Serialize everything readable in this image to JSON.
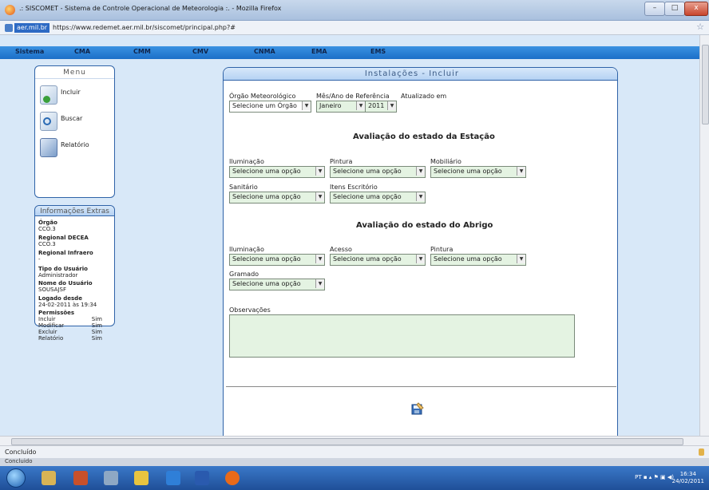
{
  "window": {
    "title": ".: SISCOMET - Sistema de Controle Operacional de Meteorologia :. - Mozilla Firefox",
    "min_label": "–",
    "max_label": "□",
    "close_label": "x"
  },
  "address": {
    "site_badge": "aer.mil.br",
    "url": "https://www.redemet.aer.mil.br/siscomet/principal.php?#"
  },
  "nav": [
    "Sistema",
    "CMA",
    "CMM",
    "CMV",
    "CNMA",
    "EMA",
    "EMS"
  ],
  "menu": {
    "heading": "Menu",
    "items": [
      {
        "label": "Incluir",
        "icon": "add-document-icon"
      },
      {
        "label": "Buscar",
        "icon": "search-icon"
      },
      {
        "label": "Relatório",
        "icon": "report-icon"
      }
    ]
  },
  "info": {
    "heading": "Informações Extras",
    "orgao_label": "Órgão",
    "orgao_value": "CCO.3",
    "regional_decea_label": "Regional DECEA",
    "regional_decea_value": "CCO.3",
    "regional_infraero_label": "Regional Infraero",
    "regional_infraero_value": "-",
    "tipo_label": "Tipo do Usuário",
    "tipo_value": "Administrador",
    "nome_label": "Nome do Usuário",
    "nome_value": "SOUSAJSF",
    "logado_label": "Logado desde",
    "logado_value": "24-02-2011 às 19:34",
    "perm_label": "Permissões",
    "permissions": [
      {
        "name": "Incluir",
        "value": "Sim"
      },
      {
        "name": "Modificar",
        "value": "Sim"
      },
      {
        "name": "Excluir",
        "value": "Sim"
      },
      {
        "name": "Relatório",
        "value": "Sim"
      }
    ]
  },
  "form": {
    "header": "Instalações - Incluir",
    "orgao_label": "Órgão Meteorológico",
    "orgao_select": "Selecione um Órgão",
    "mes_label": "Mês/Ano de Referência",
    "mes_select": "Janeiro",
    "ano_select": "2011",
    "atualizado_label": "Atualizado em",
    "section_estacao": "Avaliação do estado da Estação",
    "iluminacao_label": "Iluminação",
    "pintura_label": "Pintura",
    "mobiliario_label": "Mobiliário",
    "sanitario_label": "Sanitário",
    "itens_label": "Itens Escritório",
    "section_abrigo": "Avaliação do estado do Abrigo",
    "abrigo_iluminacao_label": "Iluminação",
    "acesso_label": "Acesso",
    "abrigo_pintura_label": "Pintura",
    "gramado_label": "Gramado",
    "option_placeholder": "Selecione uma opção",
    "observacoes_label": "Observações"
  },
  "status": {
    "text": "Concluído",
    "strip_text": "Concluido"
  },
  "taskbar": {
    "lang": "PT",
    "time": "16:34",
    "date": "24/02/2011"
  }
}
